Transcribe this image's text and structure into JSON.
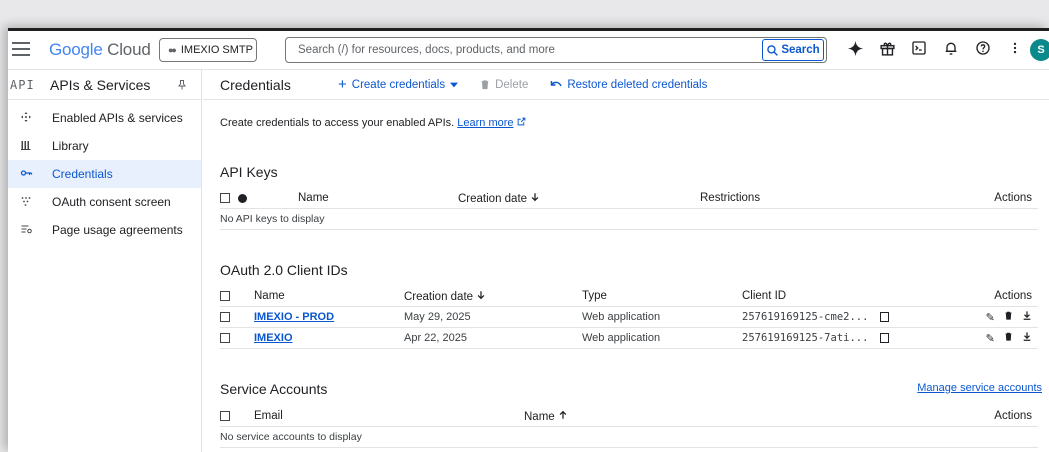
{
  "header": {
    "logo_google": "Google",
    "logo_cloud": "Cloud",
    "project": "IMEXIO SMTP",
    "search_placeholder": "Search (/) for resources, docs, products, and more",
    "search_button": "Search",
    "avatar_initial": "S"
  },
  "sidebar": {
    "api_label": "API",
    "title": "APIs & Services",
    "items": [
      {
        "label": "Enabled APIs & services",
        "icon": "diamond-arrows-icon"
      },
      {
        "label": "Library",
        "icon": "library-icon"
      },
      {
        "label": "Credentials",
        "icon": "key-icon",
        "active": true
      },
      {
        "label": "OAuth consent screen",
        "icon": "oauth-dots-icon"
      },
      {
        "label": "Page usage agreements",
        "icon": "settings-list-icon"
      }
    ]
  },
  "actionbar": {
    "title": "Credentials",
    "create": "Create credentials",
    "delete": "Delete",
    "restore": "Restore deleted credentials"
  },
  "intro": {
    "text": "Create credentials to access your enabled APIs.",
    "link": "Learn more"
  },
  "api_keys": {
    "title": "API Keys",
    "headers": {
      "name": "Name",
      "created": "Creation date",
      "restrictions": "Restrictions",
      "actions": "Actions"
    },
    "empty": "No API keys to display"
  },
  "oauth": {
    "title": "OAuth 2.0 Client IDs",
    "headers": {
      "name": "Name",
      "created": "Creation date",
      "type": "Type",
      "client_id": "Client ID",
      "actions": "Actions"
    },
    "rows": [
      {
        "name": "IMEXIO - PROD",
        "created": "May 29, 2025",
        "type": "Web application",
        "client_id": "257619169125-cme2..."
      },
      {
        "name": "IMEXIO",
        "created": "Apr 22, 2025",
        "type": "Web application",
        "client_id": "257619169125-7ati..."
      }
    ]
  },
  "service_accounts": {
    "title": "Service Accounts",
    "manage": "Manage service accounts",
    "headers": {
      "email": "Email",
      "name": "Name",
      "actions": "Actions"
    },
    "empty": "No service accounts to display"
  }
}
